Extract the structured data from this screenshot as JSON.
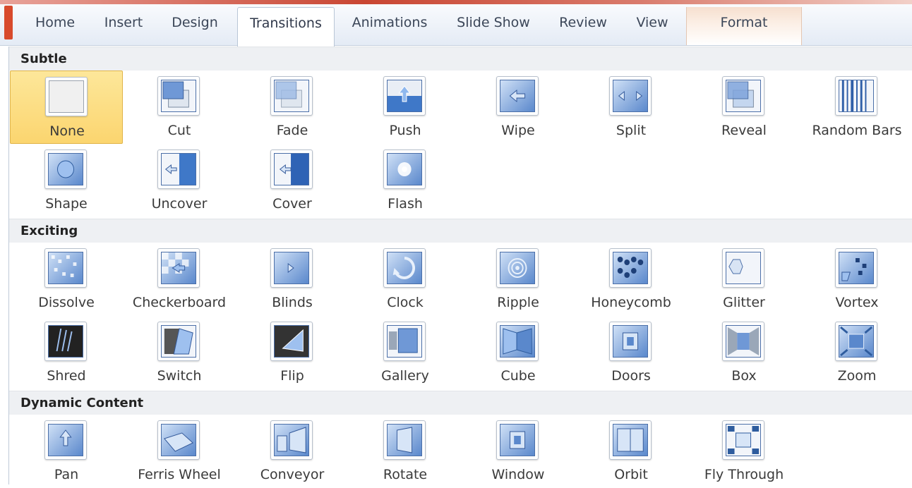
{
  "ribbon": {
    "tabs": [
      {
        "label": "Home",
        "state": "normal"
      },
      {
        "label": "Insert",
        "state": "normal"
      },
      {
        "label": "Design",
        "state": "normal"
      },
      {
        "label": "Transitions",
        "state": "active"
      },
      {
        "label": "Animations",
        "state": "normal"
      },
      {
        "label": "Slide Show",
        "state": "normal"
      },
      {
        "label": "Review",
        "state": "normal"
      },
      {
        "label": "View",
        "state": "normal"
      },
      {
        "label": "Format",
        "state": "contextual"
      }
    ]
  },
  "gallery": {
    "sections": [
      {
        "title": "Subtle",
        "items": [
          {
            "label": "None",
            "icon": "none-transition-icon",
            "selected": true
          },
          {
            "label": "Cut",
            "icon": "cut-transition-icon"
          },
          {
            "label": "Fade",
            "icon": "fade-transition-icon"
          },
          {
            "label": "Push",
            "icon": "push-transition-icon"
          },
          {
            "label": "Wipe",
            "icon": "wipe-transition-icon"
          },
          {
            "label": "Split",
            "icon": "split-transition-icon"
          },
          {
            "label": "Reveal",
            "icon": "reveal-transition-icon"
          },
          {
            "label": "Random Bars",
            "icon": "random-bars-transition-icon"
          },
          {
            "label": "Shape",
            "icon": "shape-transition-icon"
          },
          {
            "label": "Uncover",
            "icon": "uncover-transition-icon"
          },
          {
            "label": "Cover",
            "icon": "cover-transition-icon"
          },
          {
            "label": "Flash",
            "icon": "flash-transition-icon"
          }
        ]
      },
      {
        "title": "Exciting",
        "items": [
          {
            "label": "Dissolve",
            "icon": "dissolve-transition-icon"
          },
          {
            "label": "Checkerboard",
            "icon": "checkerboard-transition-icon"
          },
          {
            "label": "Blinds",
            "icon": "blinds-transition-icon"
          },
          {
            "label": "Clock",
            "icon": "clock-transition-icon"
          },
          {
            "label": "Ripple",
            "icon": "ripple-transition-icon"
          },
          {
            "label": "Honeycomb",
            "icon": "honeycomb-transition-icon"
          },
          {
            "label": "Glitter",
            "icon": "glitter-transition-icon"
          },
          {
            "label": "Vortex",
            "icon": "vortex-transition-icon"
          },
          {
            "label": "Shred",
            "icon": "shred-transition-icon"
          },
          {
            "label": "Switch",
            "icon": "switch-transition-icon"
          },
          {
            "label": "Flip",
            "icon": "flip-transition-icon"
          },
          {
            "label": "Gallery",
            "icon": "gallery-transition-icon"
          },
          {
            "label": "Cube",
            "icon": "cube-transition-icon"
          },
          {
            "label": "Doors",
            "icon": "doors-transition-icon"
          },
          {
            "label": "Box",
            "icon": "box-transition-icon"
          },
          {
            "label": "Zoom",
            "icon": "zoom-transition-icon"
          }
        ]
      },
      {
        "title": "Dynamic Content",
        "items": [
          {
            "label": "Pan",
            "icon": "pan-transition-icon"
          },
          {
            "label": "Ferris Wheel",
            "icon": "ferris-wheel-transition-icon"
          },
          {
            "label": "Conveyor",
            "icon": "conveyor-transition-icon"
          },
          {
            "label": "Rotate",
            "icon": "rotate-transition-icon"
          },
          {
            "label": "Window",
            "icon": "window-transition-icon"
          },
          {
            "label": "Orbit",
            "icon": "orbit-transition-icon"
          },
          {
            "label": "Fly Through",
            "icon": "fly-through-transition-icon"
          }
        ]
      }
    ]
  },
  "colors": {
    "selected_fill": "#fbd56f",
    "thumb_blue": "#5a88cc",
    "section_bg": "#eef0f3"
  }
}
